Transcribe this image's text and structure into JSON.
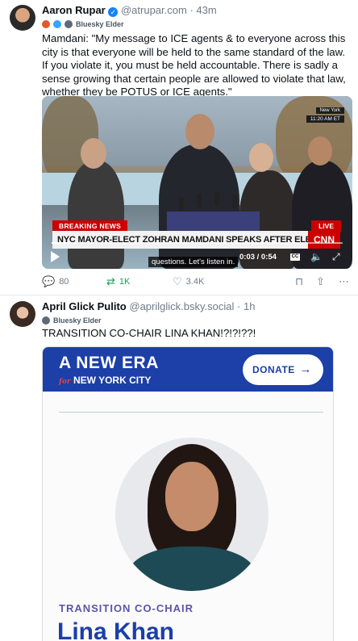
{
  "post1": {
    "author_name": "Aaron Rupar",
    "handle": "@atrupar.com",
    "time": "43m",
    "badge_label": "Bluesky Elder",
    "text": "Mamdani: \"My message to ICE agents & to everyone across this city is that everyone will be held to the same standard of the law. If you violate it, you must be held accountable. There is sadly a sense growing  that certain people are allowed to violate that law, whether they be POTUS or ICE agents.\"",
    "video": {
      "location_tag": "New York",
      "time_tag": "11:20 AM ET",
      "breaking": "BREAKING NEWS",
      "live": "LIVE",
      "chyron": "NYC MAYOR-ELECT ZOHRAN MAMDANI SPEAKS AFTER ELECTION WIN",
      "network": "CNN",
      "caption": "questions. Let's listen in.",
      "timestamp": "0:03 / 0:54",
      "progress": 0.06,
      "cc_label": "CC"
    },
    "actions": {
      "replies": "80",
      "reposts": "1K",
      "likes": "3.4K"
    }
  },
  "post2": {
    "author_name": "April Glick Pulito",
    "handle": "@aprilglick.bsky.social",
    "time": "1h",
    "badge_label": "Bluesky Elder",
    "text": "TRANSITION CO-CHAIR LINA KHAN!?!?!??!",
    "image": {
      "headline": "A NEW ERA",
      "for_label": "for",
      "city": "NEW YORK CITY",
      "donate": "DONATE",
      "role": "TRANSITION CO-CHAIR",
      "name": "Lina Khan"
    }
  },
  "colors": {
    "verified": "#1083fe",
    "repost": "#13a44d",
    "brand_blue": "#1c3fa8",
    "cnn_red": "#cc0000"
  }
}
